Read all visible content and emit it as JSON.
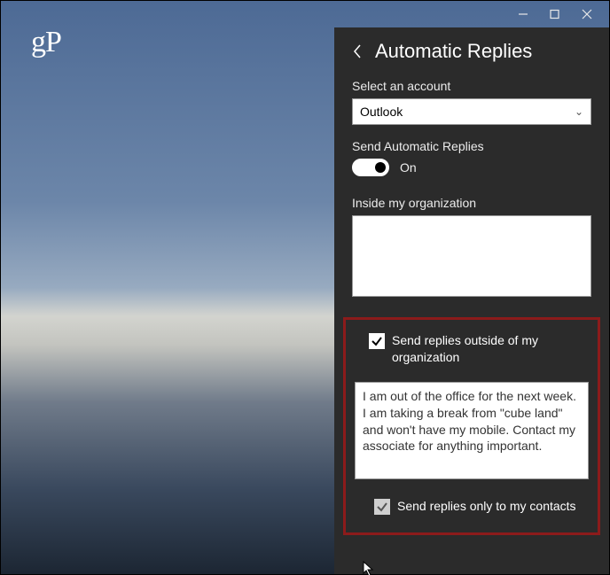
{
  "window": {
    "logo": "gP"
  },
  "panel": {
    "title": "Automatic Replies",
    "account_label": "Select an account",
    "account_value": "Outlook",
    "send_label": "Send Automatic Replies",
    "toggle_state": "On",
    "inside_label": "Inside my organization",
    "inside_text": "",
    "outside_checkbox_label": "Send replies outside of my organization",
    "outside_text": "I am out of the office for the next week. I am taking a break from \"cube land\" and won't have my mobile. Contact my associate for anything important.",
    "contacts_only_label": "Send replies only to my contacts"
  }
}
